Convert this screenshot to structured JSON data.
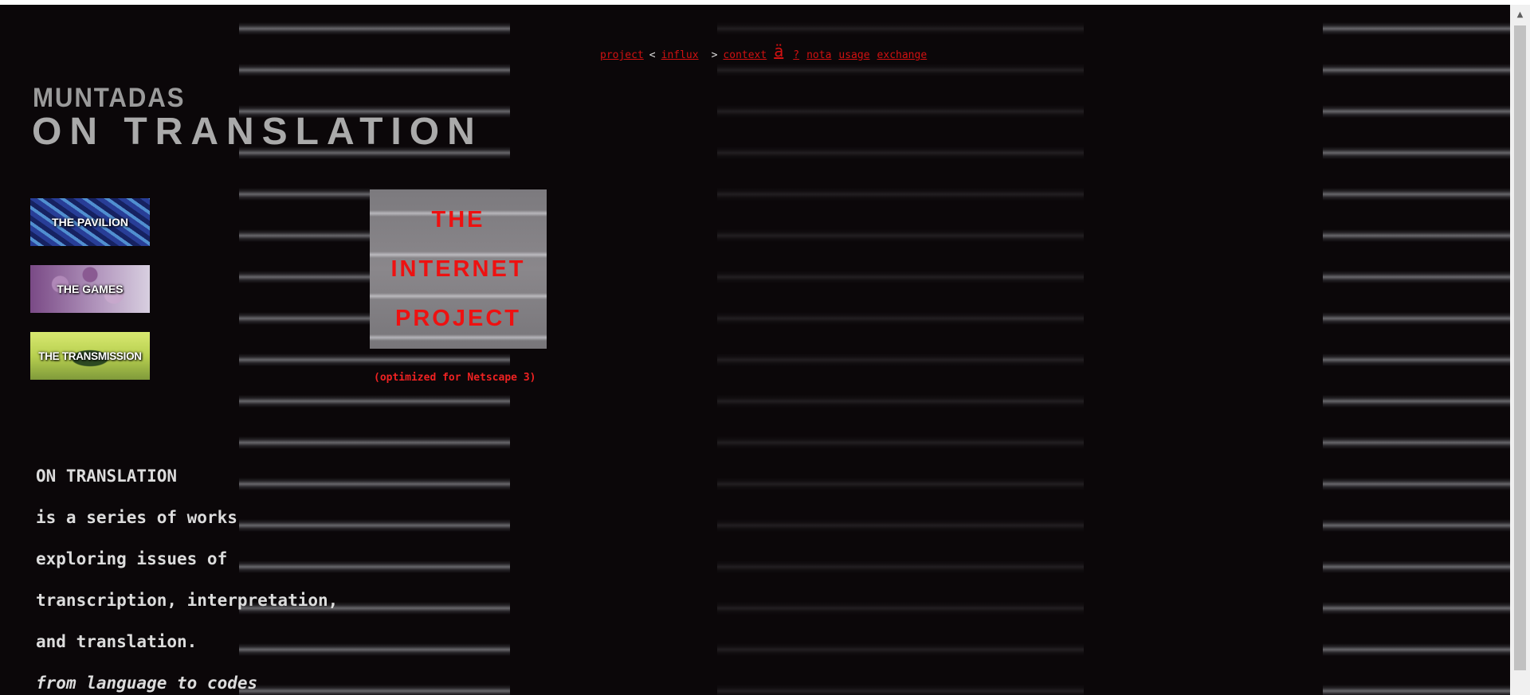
{
  "nav": {
    "project": "project",
    "lt": "<",
    "influx": "influx",
    "gt": ">",
    "context": "context",
    "glyph": "ä",
    "question": "?",
    "nota": "nota",
    "usage": "usage",
    "exchange": "exchange"
  },
  "header": {
    "artist": "MUNTADAS",
    "title": "ON TRANSLATION"
  },
  "thumbs": [
    {
      "label": "THE PAVILION"
    },
    {
      "label": "THE GAMES"
    },
    {
      "label": "THE TRANSMISSION"
    }
  ],
  "internet_project": {
    "line1": "THE",
    "line2": "INTERNET",
    "line3": "PROJECT",
    "note": "(optimized for Netscape 3)"
  },
  "description": {
    "lines": [
      "ON TRANSLATION",
      "is a series of works",
      "exploring issues of",
      "transcription, interpretation,",
      "and translation."
    ],
    "italic_line": "from language to codes"
  },
  "colors": {
    "background": "#0b0709",
    "link": "#d11111",
    "text": "#dcdcdc"
  }
}
